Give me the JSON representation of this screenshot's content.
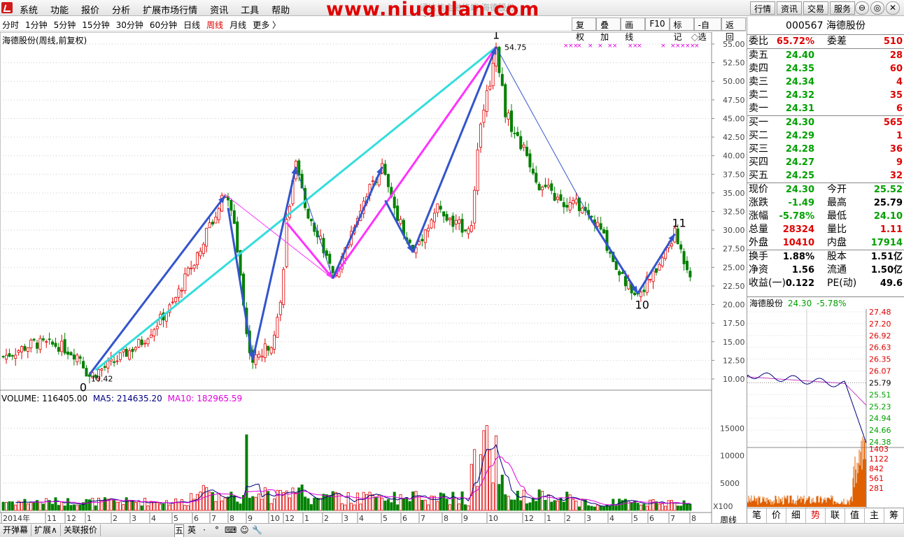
{
  "menubar": {
    "items": [
      "系统",
      "功能",
      "报价",
      "分析",
      "扩展市场行情",
      "资讯",
      "工具",
      "帮助"
    ],
    "watermark": "www.niugulan.com",
    "watermark_sub": "通达信金融终端   海德股份",
    "right_buttons": [
      "行情",
      "资讯",
      "交易",
      "服务"
    ],
    "win_controls": [
      "⊖",
      "◎",
      "✕"
    ]
  },
  "periodbar": {
    "items": [
      "分时",
      "1分钟",
      "5分钟",
      "15分钟",
      "30分钟",
      "60分钟",
      "日线",
      "周线",
      "月线",
      "更多 〉"
    ],
    "active": "周线",
    "tools": [
      "复权",
      "叠加",
      "画线",
      "F10",
      "标记",
      "-自选",
      "返回"
    ]
  },
  "chart": {
    "stock_label": "海德股份(周线,前复权)",
    "price_axis": [
      "55.00",
      "52.50",
      "50.00",
      "47.50",
      "45.00",
      "42.50",
      "40.00",
      "37.50",
      "35.00",
      "32.50",
      "30.00",
      "27.50",
      "25.00",
      "22.50",
      "20.00",
      "17.50",
      "15.00",
      "12.50",
      "10.00"
    ],
    "volume_axis": [
      "15000",
      "10000",
      "5000"
    ],
    "volume_unit": "X100",
    "time_labels": [
      "2014年",
      "11",
      "12",
      "1",
      "2",
      "3",
      "4",
      "5",
      "6",
      "7",
      "8",
      "9",
      "10",
      "12",
      "1",
      "2",
      "3",
      "4",
      "5",
      "6",
      "7",
      "8",
      "9",
      "10",
      "12",
      "1",
      "2",
      "3",
      "4",
      "5",
      "6",
      "7",
      "8"
    ],
    "period_label": "周线",
    "annotations": {
      "wave_0": "0",
      "wave_1": "1",
      "wave_10": "10",
      "wave_11": "11",
      "low_price": "10.42",
      "high_price": "54.75"
    },
    "volume_legend": {
      "volume": "VOLUME: 116405.00",
      "ma5": "MA5: 214635.20",
      "ma10": "MA10: 182965.59"
    },
    "colors": {
      "up": "#e00000",
      "down": "#008000",
      "ma5": "#000080",
      "ma10": "#e000e0",
      "blue_arrow": "#3355cc",
      "cyan": "#33dddd",
      "magenta": "#ff33ff"
    }
  },
  "chart_data": {
    "type": "candlestick",
    "title": "海德股份(周线,前复权)",
    "price_range": [
      10,
      55
    ],
    "low": 10.42,
    "high": 54.75,
    "waves": [
      {
        "label": "0",
        "price": 10.42
      },
      {
        "label": "1",
        "price": 54.75
      },
      {
        "label": "10",
        "price": 21.5
      },
      {
        "label": "11",
        "price": 29.5
      }
    ],
    "volume": {
      "current": 116405.0,
      "ma5": 214635.2,
      "ma10": 182965.59,
      "ylim": [
        0,
        19000
      ]
    }
  },
  "quote": {
    "code_name": "000567 海德股份",
    "weibi_label": "委比",
    "weibi": "65.72%",
    "weicha_label": "委差",
    "weicha": "510",
    "asks": [
      {
        "label": "卖五",
        "price": "24.40",
        "vol": "28"
      },
      {
        "label": "卖四",
        "price": "24.35",
        "vol": "60"
      },
      {
        "label": "卖三",
        "price": "24.34",
        "vol": "4"
      },
      {
        "label": "卖二",
        "price": "24.32",
        "vol": "35"
      },
      {
        "label": "卖一",
        "price": "24.31",
        "vol": "6"
      }
    ],
    "bids": [
      {
        "label": "买一",
        "price": "24.30",
        "vol": "565"
      },
      {
        "label": "买二",
        "price": "24.29",
        "vol": "1"
      },
      {
        "label": "买三",
        "price": "24.28",
        "vol": "36"
      },
      {
        "label": "买四",
        "price": "24.27",
        "vol": "9"
      },
      {
        "label": "买五",
        "price": "24.25",
        "vol": "32"
      }
    ],
    "stats": [
      {
        "l1": "现价",
        "v1": "24.30",
        "c1": "green",
        "l2": "今开",
        "v2": "25.52",
        "c2": "green"
      },
      {
        "l1": "涨跌",
        "v1": "-1.49",
        "c1": "green",
        "l2": "最高",
        "v2": "25.79",
        "c2": "black"
      },
      {
        "l1": "涨幅",
        "v1": "-5.78%",
        "c1": "green",
        "l2": "最低",
        "v2": "24.10",
        "c2": "green"
      },
      {
        "l1": "总量",
        "v1": "28324",
        "c1": "red",
        "l2": "量比",
        "v2": "1.11",
        "c2": "red"
      },
      {
        "l1": "外盘",
        "v1": "10410",
        "c1": "red",
        "l2": "内盘",
        "v2": "17914",
        "c2": "green"
      }
    ],
    "stats2": [
      {
        "l1": "换手",
        "v1": "1.88%",
        "l2": "股本",
        "v2": "1.51亿"
      },
      {
        "l1": "净资",
        "v1": "1.56",
        "l2": "流通",
        "v2": "1.50亿"
      },
      {
        "l1": "收益(一)",
        "v1": "0.122",
        "l2": "PE(动)",
        "v2": "49.6"
      }
    ]
  },
  "mini_chart": {
    "title": "海德股份",
    "price": "24.30",
    "change": "-5.78%",
    "price_axis": [
      "27.48",
      "27.20",
      "26.92",
      "26.63",
      "26.35",
      "26.07",
      "25.79",
      "25.51",
      "25.23",
      "24.94",
      "24.66",
      "24.38"
    ],
    "volume_axis": [
      "1403",
      "1122",
      "842",
      "561",
      "281"
    ]
  },
  "right_tabs": [
    "笔",
    "价",
    "细",
    "势",
    "联",
    "值",
    "主",
    "筹"
  ],
  "right_tab_active": "势",
  "bottom": {
    "left_items": [
      "开弹幕",
      "扩展∧",
      "关联报价"
    ],
    "tools": [
      "五",
      "英",
      "·",
      "°",
      "⌨",
      "☺",
      "🔧"
    ]
  }
}
